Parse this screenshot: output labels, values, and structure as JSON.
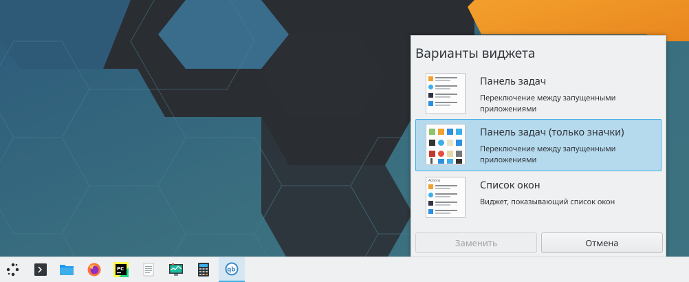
{
  "popup": {
    "title": "Варианты виджета",
    "options": [
      {
        "title": "Панель задач",
        "description": "Переключение между запущенными приложениями",
        "selected": false
      },
      {
        "title": "Панель задач (только значки)",
        "description": "Переключение между запущенными приложениями",
        "selected": true
      },
      {
        "title": "Список окон",
        "description": "Виджет, показывающий список окон",
        "selected": false
      }
    ],
    "thumb_texts": {
      "window_list_header": "Actions"
    },
    "buttons": {
      "replace": "Заменить",
      "cancel": "Отмена"
    }
  },
  "taskbar": {
    "items": [
      {
        "icon": "application-launcher-icon"
      },
      {
        "icon": "terminal-icon"
      },
      {
        "icon": "folder-icon"
      },
      {
        "icon": "firefox-icon"
      },
      {
        "icon": "pycharm-icon"
      },
      {
        "icon": "text-editor-icon"
      },
      {
        "icon": "system-monitor-icon"
      },
      {
        "icon": "calculator-icon"
      },
      {
        "icon": "qbittorrent-icon",
        "active": true
      }
    ]
  },
  "colors": {
    "accent": "#3daee9",
    "selection": "#b5d9ed",
    "panel_bg": "#eff0f1",
    "wallpaper_blue": "#2f5f7f",
    "wallpaper_teal": "#3f7480",
    "wallpaper_dark": "#2b2e33",
    "wallpaper_orange": "#f29b2a"
  }
}
